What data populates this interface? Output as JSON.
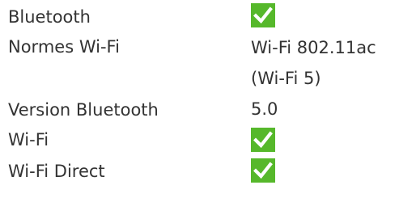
{
  "specs": [
    {
      "label": "Bluetooth",
      "value_type": "check",
      "icon": "check-icon"
    },
    {
      "label": "Normes Wi-Fi",
      "value_type": "text",
      "value_lines": [
        "Wi-Fi 802.11ac",
        "(Wi-Fi 5)"
      ]
    },
    {
      "label": "Version Bluetooth",
      "value_type": "text",
      "value_lines": [
        "5.0"
      ]
    },
    {
      "label": "Wi-Fi",
      "value_type": "check",
      "icon": "check-icon"
    },
    {
      "label": "Wi-Fi Direct",
      "value_type": "check",
      "icon": "check-icon"
    }
  ],
  "colors": {
    "text": "#333333",
    "check_background": "#56b82b",
    "check_mark": "#ffffff"
  }
}
